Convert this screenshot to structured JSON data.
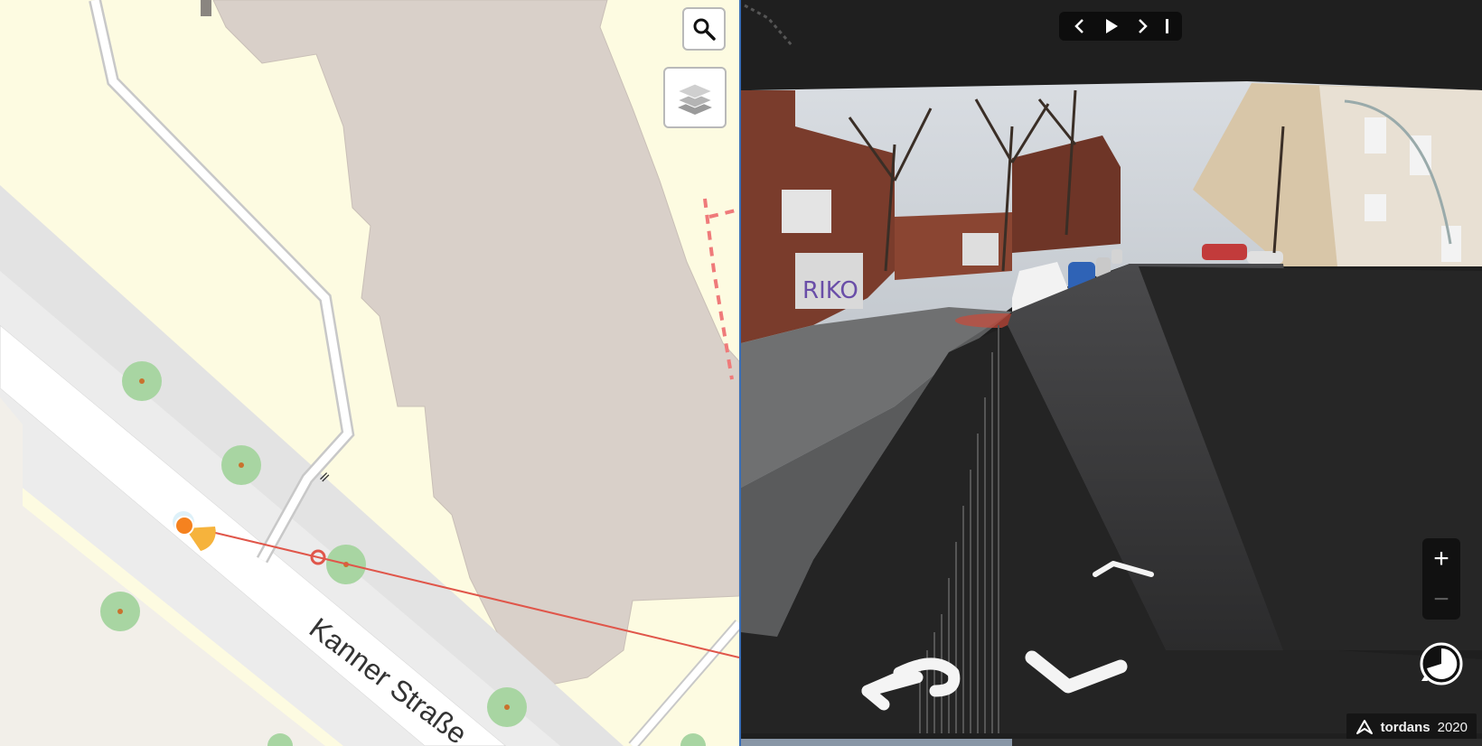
{
  "map": {
    "street_label": "Kanner Straße",
    "search_button": "search-icon",
    "layers_button": "layers-icon",
    "colors": {
      "background": "#fdfbe1",
      "building": "#d9d0c9",
      "road": "#ffffff",
      "sidewalk": "#e6e6e6",
      "tree": "#a8d5a2",
      "sequence_line": "#e0564a",
      "position_marker": "#f5821f",
      "view_cone": "#f6b33c"
    }
  },
  "viewer": {
    "sequence_controls": {
      "previous": "chevron-left-icon",
      "play": "play-icon",
      "next": "chevron-right-icon",
      "stop": "stop-bar-icon"
    },
    "zoom": {
      "in_label": "+",
      "out_label": "−"
    },
    "attribution": {
      "creator": "tordans",
      "year": "2020",
      "icon": "mapillary-logo-icon"
    },
    "navigation_arrows": [
      "turn-back-arrow-icon",
      "step-backward-arrow-icon",
      "step-forward-arrow-icon"
    ]
  }
}
